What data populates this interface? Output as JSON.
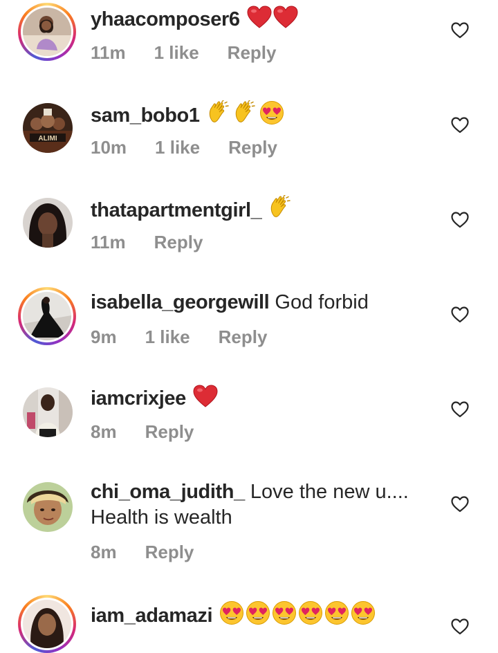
{
  "comments": [
    {
      "username": "yhaacomposer6",
      "text": "",
      "emoji": [
        "red-heart",
        "red-heart"
      ],
      "time": "11m",
      "likes": "1 like",
      "reply": "Reply",
      "story": true
    },
    {
      "username": "sam_bobo1",
      "text": "",
      "emoji": [
        "clapping-hands",
        "clapping-hands",
        "heart-eyes"
      ],
      "time": "10m",
      "likes": "1 like",
      "reply": "Reply",
      "story": false,
      "avatar_caption": "ALIMI"
    },
    {
      "username": "thatapartmentgirl_",
      "text": "",
      "emoji": [
        "clapping-hands"
      ],
      "time": "11m",
      "likes": "",
      "reply": "Reply",
      "story": false
    },
    {
      "username": "isabella_georgewill",
      "text": "God forbid",
      "emoji": [],
      "time": "9m",
      "likes": "1 like",
      "reply": "Reply",
      "story": true
    },
    {
      "username": "iamcrixjee",
      "text": "",
      "emoji": [
        "red-heart"
      ],
      "time": "8m",
      "likes": "",
      "reply": "Reply",
      "story": false
    },
    {
      "username": "chi_oma_judith_",
      "text": "Love the new u....",
      "text2": "Health is wealth",
      "emoji": [],
      "time": "8m",
      "likes": "",
      "reply": "Reply",
      "story": false
    },
    {
      "username": "iam_adamazi",
      "text": "",
      "emoji": [
        "heart-eyes",
        "heart-eyes",
        "heart-eyes",
        "heart-eyes",
        "heart-eyes",
        "heart-eyes"
      ],
      "time": "",
      "likes": "",
      "reply": "",
      "story": true
    }
  ],
  "icons": {
    "like": "heart-outline-icon"
  },
  "colors": {
    "text": "#262626",
    "meta": "#8e8e8e",
    "red_heart": "#e0245e"
  }
}
